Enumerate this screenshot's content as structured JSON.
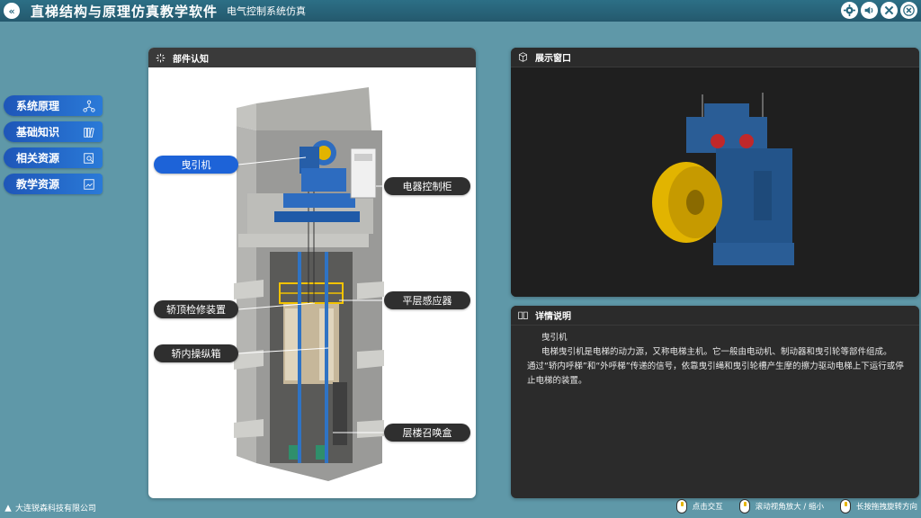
{
  "header": {
    "back_icon": "double-chevron-left-icon",
    "title": "直梯结构与原理仿真教学软件",
    "subtitle": "电气控制系统仿真",
    "icons": [
      "gear-icon",
      "speaker-icon",
      "tools-icon",
      "close-icon"
    ]
  },
  "sidebar": {
    "items": [
      {
        "label": "系统原理",
        "icon": "network-icon"
      },
      {
        "label": "基础知识",
        "icon": "book-icon"
      },
      {
        "label": "相关资源",
        "icon": "search-doc-icon"
      },
      {
        "label": "教学资源",
        "icon": "image-icon"
      }
    ]
  },
  "left_panel": {
    "title": "部件认知",
    "labels": {
      "traction": "曳引机",
      "control_cabinet": "电器控制柜",
      "leveling_sensor": "平层感应器",
      "car_top": "轿顶检修装置",
      "car_panel": "轿内操纵箱",
      "hall_call": "层楼召唤盒"
    }
  },
  "display_panel": {
    "title": "展示窗口"
  },
  "detail_panel": {
    "title": "详情说明",
    "item_title": "曳引机",
    "line1": "电梯曳引机是电梯的动力源，又称电梯主机。它一般由电动机、制动器和曳引轮等部件组成。",
    "line2": "通过“轿内呼梯”和“外呼梯”传递的信号，依靠曳引绳和曳引轮槽产生摩的擦力驱动电梯上下运行或停止电梯的装置。"
  },
  "footer": {
    "company": "大连锐森科技有限公司",
    "hints": [
      "点击交互",
      "滚动视角放大 / 缩小",
      "长按拖拽旋转方向"
    ]
  },
  "colors": {
    "accent": "#1d63d8",
    "background": "#5f98a8",
    "panel_dark": "#2b2b2b"
  }
}
